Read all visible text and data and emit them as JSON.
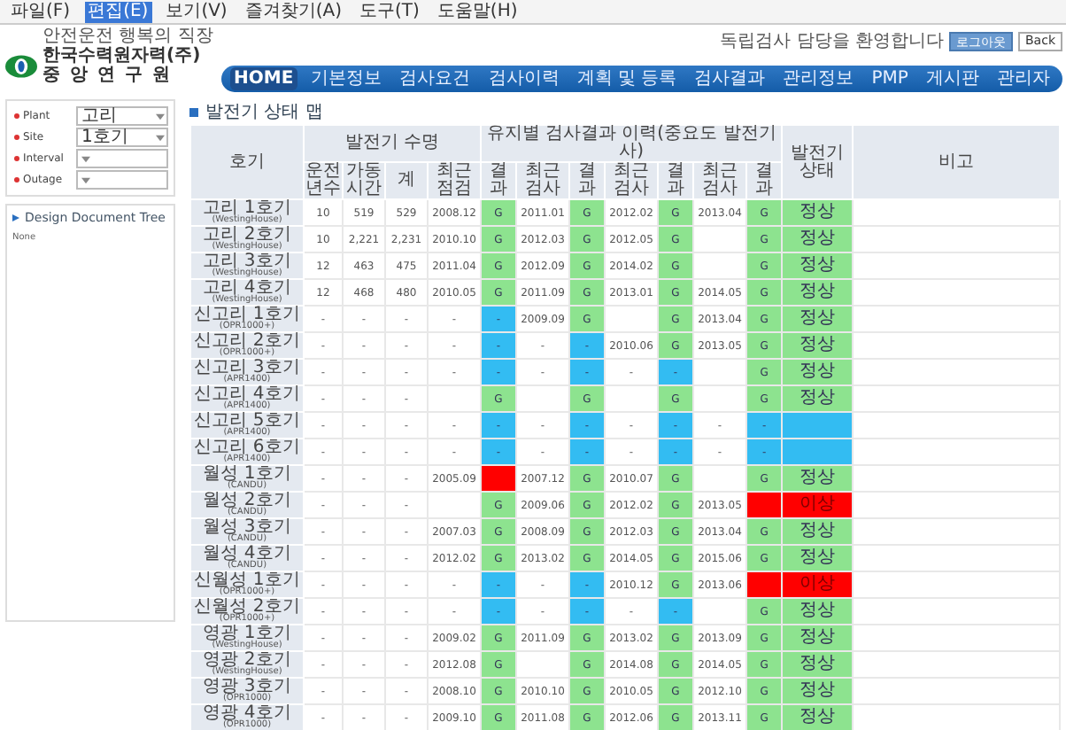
{
  "menu_bar": [
    {
      "label": "파일(F)",
      "selected": false
    },
    {
      "label": "편집(E)",
      "selected": true
    },
    {
      "label": "보기(V)",
      "selected": false
    },
    {
      "label": "즐겨찾기(A)",
      "selected": false
    },
    {
      "label": "도구(T)",
      "selected": false
    },
    {
      "label": "도움말(H)",
      "selected": false
    }
  ],
  "logo": {
    "slogan": "안전운전 행복의 직장",
    "company": "한국수력원자력(주)",
    "division": "중 앙 연 구 원"
  },
  "user_bar": {
    "welcome": "독립검사 담당을 환영합니다",
    "buttons": [
      "로그아웃",
      "Back"
    ]
  },
  "nav": [
    {
      "label": "HOME",
      "selected": true
    },
    {
      "label": "기본정보",
      "selected": false
    },
    {
      "label": "검사요건",
      "selected": false
    },
    {
      "label": "검사이력",
      "selected": false
    },
    {
      "label": "계획 및 등록",
      "selected": false
    },
    {
      "label": "검사결과",
      "selected": false
    },
    {
      "label": "관리정보",
      "selected": false
    },
    {
      "label": "PMP",
      "selected": false
    },
    {
      "label": "게시판",
      "selected": false
    },
    {
      "label": "관리자",
      "selected": false
    }
  ],
  "filters": [
    {
      "label": "Plant",
      "value": "고리"
    },
    {
      "label": "Site",
      "value": "1호기"
    },
    {
      "label": "Interval"
    },
    {
      "label": "Outage"
    }
  ],
  "tree_panel": {
    "title": "Design Document Tree",
    "empty_text": "None"
  },
  "page_title": "발전기 상태 맵",
  "table": {
    "group_headers": [
      "호기",
      "발전기 수명",
      "유지별 검사결과 이력(중요도 발전기 사)",
      "발전기 상태",
      "비고"
    ],
    "columns": [
      "운전년수",
      "가동시간",
      "계",
      "최근 점검",
      "결과",
      "최근 검사",
      "결과",
      "최근 검사",
      "결과",
      "최근 검사",
      "결과"
    ],
    "rows": [
      {
        "name": "고리 1호기",
        "model": "(WestingHouse)",
        "life": [
          "10",
          "519",
          "529"
        ],
        "checks": [
          {
            "date": "2008.12",
            "color": "#8de38f",
            "text": "G"
          },
          {
            "date": "2011.01",
            "color": "#8de38f",
            "text": "G"
          },
          {
            "date": "2012.02",
            "color": "#8de38f",
            "text": "G"
          },
          {
            "date": "2013.04",
            "color": "#8de38f",
            "text": "G"
          }
        ],
        "state": {
          "color": "#8de38f",
          "text": "정상"
        }
      },
      {
        "name": "고리 2호기",
        "model": "(WestingHouse)",
        "life": [
          "10",
          "2,221",
          "2,231"
        ],
        "checks": [
          {
            "date": "2010.10",
            "color": "#8de38f",
            "text": "G"
          },
          {
            "date": "2012.03",
            "color": "#8de38f",
            "text": "G"
          },
          {
            "date": "2012.05",
            "color": "#8de38f",
            "text": "G"
          },
          {
            "color": "#8de38f",
            "text": "G"
          }
        ],
        "state": {
          "color": "#8de38f",
          "text": "정상"
        }
      },
      {
        "name": "고리 3호기",
        "model": "(WestingHouse)",
        "life": [
          "12",
          "463",
          "475"
        ],
        "checks": [
          {
            "date": "2011.04",
            "color": "#8de38f",
            "text": "G"
          },
          {
            "date": "2012.09",
            "color": "#8de38f",
            "text": "G"
          },
          {
            "date": "2014.02",
            "color": "#8de38f",
            "text": "G"
          },
          {
            "color": "#8de38f",
            "text": "G"
          }
        ],
        "state": {
          "color": "#8de38f",
          "text": "정상"
        }
      },
      {
        "name": "고리 4호기",
        "model": "(WestingHouse)",
        "life": [
          "12",
          "468",
          "480"
        ],
        "checks": [
          {
            "date": "2010.05",
            "color": "#8de38f",
            "text": "G"
          },
          {
            "date": "2011.09",
            "color": "#8de38f",
            "text": "G"
          },
          {
            "date": "2013.01",
            "color": "#8de38f",
            "text": "G"
          },
          {
            "date": "2014.05",
            "color": "#8de38f",
            "text": "G"
          }
        ],
        "state": {
          "color": "#8de38f",
          "text": "정상"
        }
      },
      {
        "name": "신고리 1호기",
        "model": "(OPR1000+)",
        "life": [
          "-",
          "-",
          "-"
        ],
        "checks": [
          {
            "date": "-",
            "color": "#33bcf2",
            "text": "-"
          },
          {
            "date": "2009.09",
            "color": "#8de38f",
            "text": "G"
          },
          {
            "color": "#8de38f",
            "text": "G"
          },
          {
            "date": "2013.04",
            "color": "#8de38f",
            "text": "G"
          }
        ],
        "state": {
          "color": "#8de38f",
          "text": "정상"
        }
      },
      {
        "name": "신고리 2호기",
        "model": "(OPR1000+)",
        "life": [
          "-",
          "-",
          "-"
        ],
        "checks": [
          {
            "date": "-",
            "color": "#33bcf2",
            "text": "-"
          },
          {
            "date": "-",
            "color": "#33bcf2",
            "text": "-"
          },
          {
            "date": "2010.06",
            "color": "#8de38f",
            "text": "G"
          },
          {
            "date": "2013.05",
            "color": "#8de38f",
            "text": "G"
          }
        ],
        "state": {
          "color": "#8de38f",
          "text": "정상"
        }
      },
      {
        "name": "신고리 3호기",
        "model": "(APR1400)",
        "life": [
          "-",
          "-",
          "-"
        ],
        "checks": [
          {
            "date": "-",
            "color": "#33bcf2",
            "text": "-"
          },
          {
            "date": "-",
            "color": "#33bcf2",
            "text": "-"
          },
          {
            "date": "-",
            "color": "#33bcf2",
            "text": "-"
          },
          {
            "color": "#8de38f",
            "text": "G"
          }
        ],
        "state": {
          "color": "#8de38f",
          "text": "정상"
        }
      },
      {
        "name": "신고리 4호기",
        "model": "(APR1400)",
        "life": [
          "-",
          "-",
          "-"
        ],
        "checks": [
          {
            "color": "#8de38f",
            "text": "G"
          },
          {
            "color": "#8de38f",
            "text": "G"
          },
          {
            "color": "#8de38f",
            "text": "G"
          },
          {
            "color": "#8de38f",
            "text": "G"
          }
        ],
        "state": {
          "color": "#8de38f",
          "text": "정상"
        }
      },
      {
        "name": "신고리 5호기",
        "model": "(APR1400)",
        "life": [
          "-",
          "-",
          "-"
        ],
        "checks": [
          {
            "date": "-",
            "color": "#33bcf2",
            "text": "-"
          },
          {
            "date": "-",
            "color": "#33bcf2",
            "text": "-"
          },
          {
            "date": "-",
            "color": "#33bcf2",
            "text": "-"
          },
          {
            "date": "-",
            "color": "#33bcf2",
            "text": "-"
          }
        ],
        "state": {
          "color": "#33bcf2"
        }
      },
      {
        "name": "신고리 6호기",
        "model": "(APR1400)",
        "life": [
          "-",
          "-",
          "-"
        ],
        "checks": [
          {
            "date": "-",
            "color": "#33bcf2",
            "text": "-"
          },
          {
            "date": "-",
            "color": "#33bcf2",
            "text": "-"
          },
          {
            "date": "-",
            "color": "#33bcf2",
            "text": "-"
          },
          {
            "date": "-",
            "color": "#33bcf2",
            "text": "-"
          }
        ],
        "state": {
          "color": "#33bcf2"
        }
      },
      {
        "name": "월성 1호기",
        "model": "(CANDU)",
        "life": [
          "-",
          "-",
          "-"
        ],
        "checks": [
          {
            "date": "2005.09",
            "color": "#ff0000"
          },
          {
            "date": "2007.12",
            "color": "#8de38f",
            "text": "G"
          },
          {
            "date": "2010.07",
            "color": "#8de38f",
            "text": "G"
          },
          {
            "color": "#8de38f",
            "text": "G"
          }
        ],
        "state": {
          "color": "#8de38f",
          "text": "정상"
        }
      },
      {
        "name": "월성 2호기",
        "model": "(CANDU)",
        "life": [
          "-",
          "-",
          "-"
        ],
        "checks": [
          {
            "color": "#8de38f",
            "text": "G"
          },
          {
            "date": "2009.06",
            "color": "#8de38f",
            "text": "G"
          },
          {
            "date": "2012.02",
            "color": "#8de38f",
            "text": "G"
          },
          {
            "date": "2013.05",
            "color": "#ff0000"
          }
        ],
        "state": {
          "color": "#ff0000",
          "text": "이상"
        }
      },
      {
        "name": "월성 3호기",
        "model": "(CANDU)",
        "life": [
          "-",
          "-",
          "-"
        ],
        "checks": [
          {
            "date": "2007.03",
            "color": "#8de38f",
            "text": "G"
          },
          {
            "date": "2008.09",
            "color": "#8de38f",
            "text": "G"
          },
          {
            "date": "2012.03",
            "color": "#8de38f",
            "text": "G"
          },
          {
            "date": "2013.04",
            "color": "#8de38f",
            "text": "G"
          }
        ],
        "state": {
          "color": "#8de38f",
          "text": "정상"
        }
      },
      {
        "name": "월성 4호기",
        "model": "(CANDU)",
        "life": [
          "-",
          "-",
          "-"
        ],
        "checks": [
          {
            "date": "2012.02",
            "color": "#8de38f",
            "text": "G"
          },
          {
            "date": "2013.02",
            "color": "#8de38f",
            "text": "G"
          },
          {
            "date": "2014.05",
            "color": "#8de38f",
            "text": "G"
          },
          {
            "date": "2015.06",
            "color": "#8de38f",
            "text": "G"
          }
        ],
        "state": {
          "color": "#8de38f",
          "text": "정상"
        }
      },
      {
        "name": "신월성 1호기",
        "model": "(OPR1000+)",
        "life": [
          "-",
          "-",
          "-"
        ],
        "checks": [
          {
            "date": "-",
            "color": "#33bcf2",
            "text": "-"
          },
          {
            "date": "-",
            "color": "#33bcf2",
            "text": "-"
          },
          {
            "date": "2010.12",
            "color": "#8de38f",
            "text": "G"
          },
          {
            "date": "2013.06",
            "color": "#ff0000"
          }
        ],
        "state": {
          "color": "#ff0000",
          "text": "이상"
        }
      },
      {
        "name": "신월성 2호기",
        "model": "(OPR1000+)",
        "life": [
          "-",
          "-",
          "-"
        ],
        "checks": [
          {
            "date": "-",
            "color": "#33bcf2",
            "text": "-"
          },
          {
            "date": "-",
            "color": "#33bcf2",
            "text": "-"
          },
          {
            "date": "-",
            "color": "#33bcf2",
            "text": "-"
          },
          {
            "color": "#8de38f",
            "text": "G"
          }
        ],
        "state": {
          "color": "#8de38f",
          "text": "정상"
        }
      },
      {
        "name": "영광 1호기",
        "model": "(WestingHouse)",
        "life": [
          "-",
          "-",
          "-"
        ],
        "checks": [
          {
            "date": "2009.02",
            "color": "#8de38f",
            "text": "G"
          },
          {
            "date": "2011.09",
            "color": "#8de38f",
            "text": "G"
          },
          {
            "date": "2013.02",
            "color": "#8de38f",
            "text": "G"
          },
          {
            "date": "2013.09",
            "color": "#8de38f",
            "text": "G"
          }
        ],
        "state": {
          "color": "#8de38f",
          "text": "정상"
        }
      },
      {
        "name": "영광 2호기",
        "model": "(WestingHouse)",
        "life": [
          "-",
          "-",
          "-"
        ],
        "checks": [
          {
            "date": "2012.08",
            "color": "#8de38f",
            "text": "G"
          },
          {
            "color": "#8de38f",
            "text": "G"
          },
          {
            "date": "2014.08",
            "color": "#8de38f",
            "text": "G"
          },
          {
            "date": "2014.05",
            "color": "#8de38f",
            "text": "G"
          }
        ],
        "state": {
          "color": "#8de38f",
          "text": "정상"
        }
      },
      {
        "name": "영광 3호기",
        "model": "(OPR1000)",
        "life": [
          "-",
          "-",
          "-"
        ],
        "checks": [
          {
            "date": "2008.10",
            "color": "#8de38f",
            "text": "G"
          },
          {
            "date": "2010.10",
            "color": "#8de38f",
            "text": "G"
          },
          {
            "date": "2010.05",
            "color": "#8de38f",
            "text": "G"
          },
          {
            "date": "2012.10",
            "color": "#8de38f",
            "text": "G"
          }
        ],
        "state": {
          "color": "#8de38f",
          "text": "정상"
        }
      },
      {
        "name": "영광 4호기",
        "model": "(OPR1000)",
        "life": [
          "-",
          "-",
          "-"
        ],
        "checks": [
          {
            "date": "2009.10",
            "color": "#8de38f",
            "text": "G"
          },
          {
            "date": "2011.08",
            "color": "#8de38f",
            "text": "G"
          },
          {
            "date": "2012.06",
            "color": "#8de38f",
            "text": "G"
          },
          {
            "date": "2013.11",
            "color": "#8de38f",
            "text": "G"
          }
        ],
        "state": {
          "color": "#8de38f",
          "text": "정상"
        }
      }
    ]
  }
}
